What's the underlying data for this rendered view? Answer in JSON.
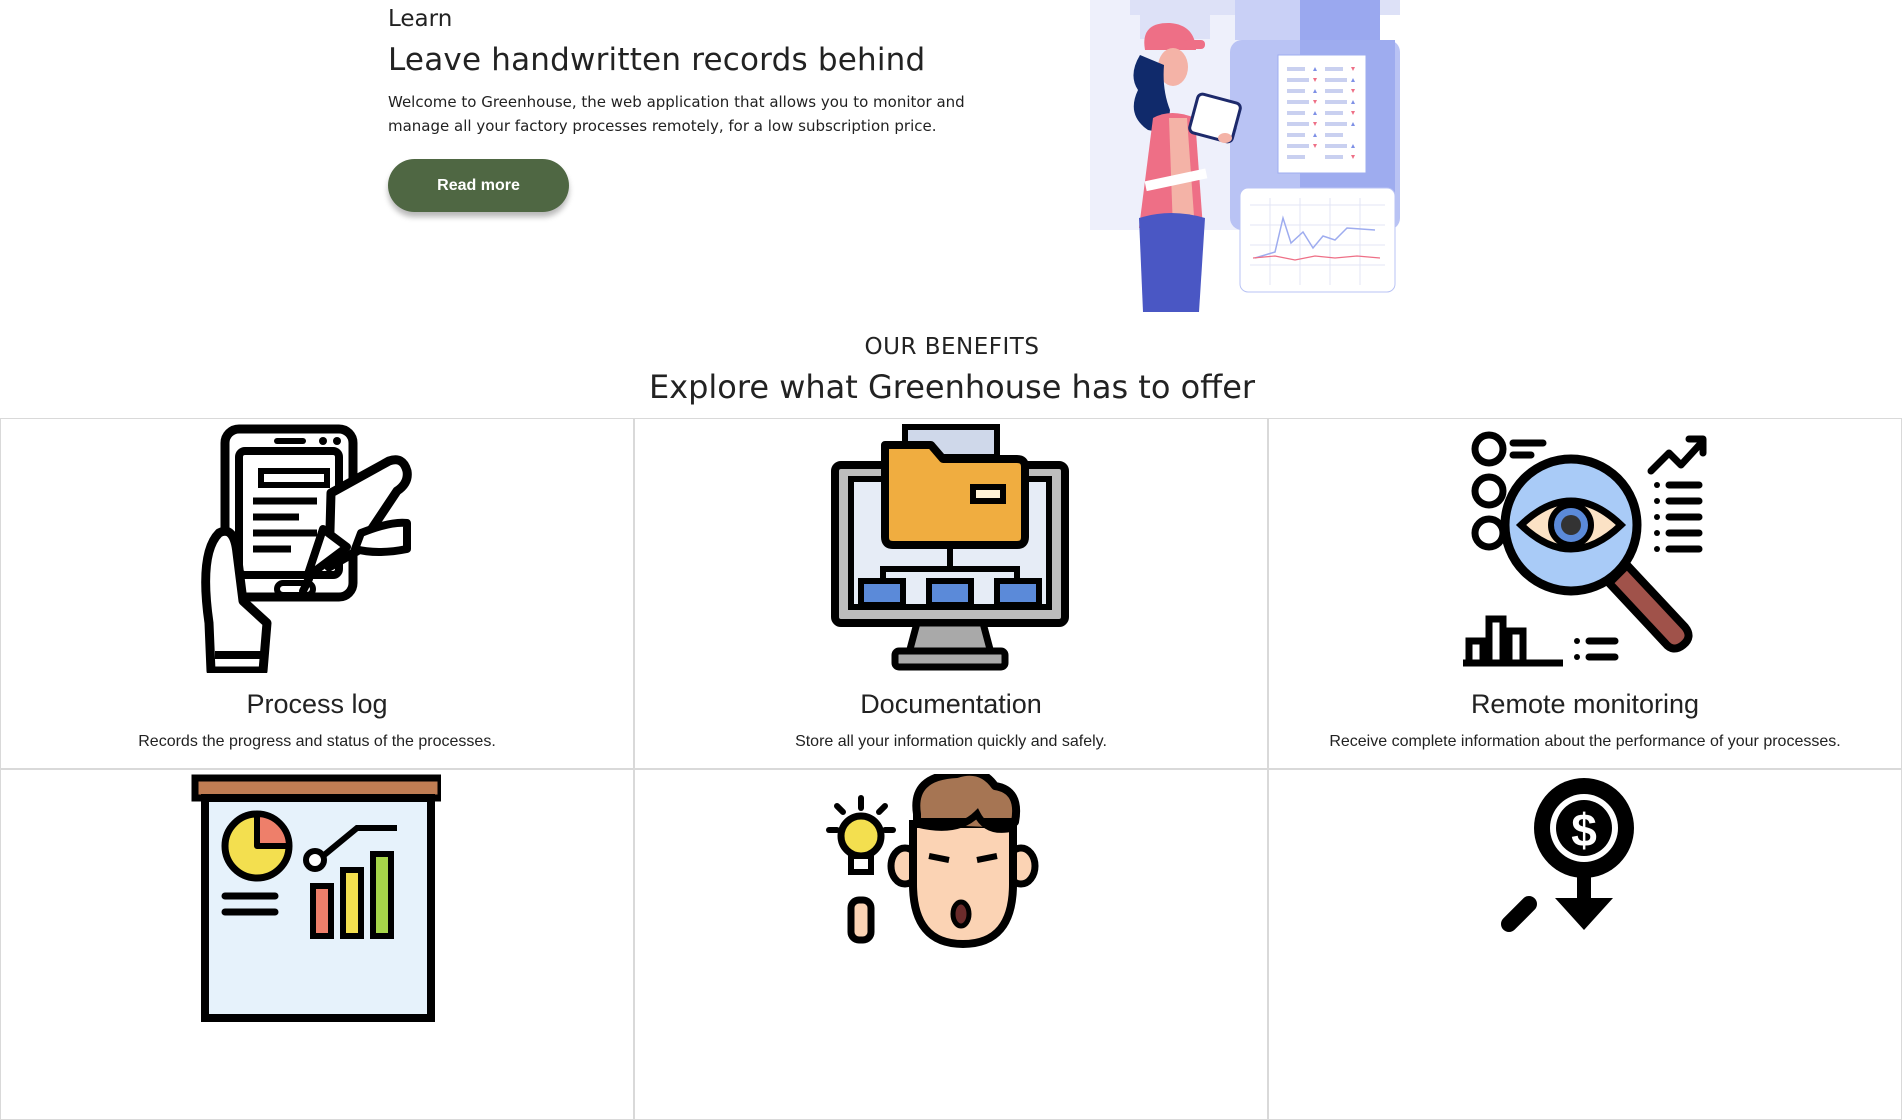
{
  "hero": {
    "eyebrow": "Learn",
    "title": "Leave handwritten records behind",
    "description": "Welcome to Greenhouse, the web application that allows you to monitor and manage all your factory processes remotely, for a low subscription price.",
    "button_label": "Read more",
    "illustration_icon": "worker-with-tablet-dashboard-illustration"
  },
  "benefits": {
    "eyebrow": "OUR BENEFITS",
    "title": "Explore what Greenhouse has to offer",
    "cards": [
      {
        "title": "Process log",
        "description": "Records the progress and status of the processes.",
        "icon": "tablet-writing-icon"
      },
      {
        "title": "Documentation",
        "description": "Store all your information quickly and safely.",
        "icon": "folder-monitor-icon"
      },
      {
        "title": "Remote monitoring",
        "description": "Receive complete information about the performance of your processes.",
        "icon": "magnifier-eye-icon"
      },
      {
        "title": "",
        "description": "",
        "icon": "presentation-board-icon"
      },
      {
        "title": "",
        "description": "",
        "icon": "person-idea-icon"
      },
      {
        "title": "",
        "description": "",
        "icon": "dollar-pin-icon"
      }
    ]
  },
  "colors": {
    "button": "#4f6743",
    "accent_orange": "#f0ad40",
    "accent_blue": "#5b8ad9",
    "accent_pink": "#ee6f86"
  }
}
